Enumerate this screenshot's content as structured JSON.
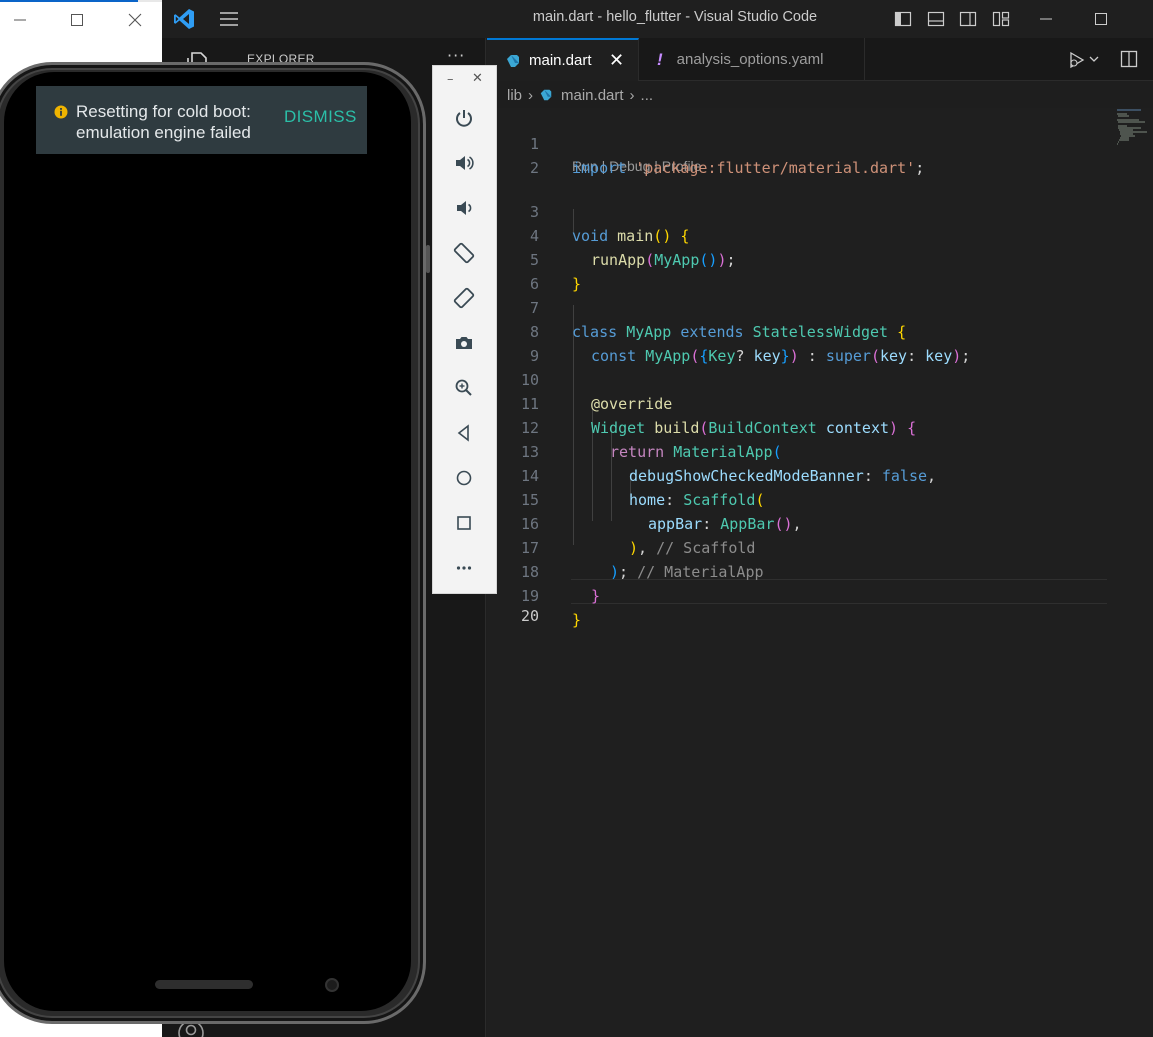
{
  "window": {
    "title": "main.dart - hello_flutter - Visual Studio Code"
  },
  "sidebar": {
    "title": "EXPLORER",
    "more": "···"
  },
  "tabs": [
    {
      "label": "main.dart",
      "active": true,
      "close": "✕"
    },
    {
      "label": "analysis_options.yaml",
      "active": false,
      "icon": "!"
    }
  ],
  "breadcrumb": {
    "folder": "lib",
    "file": "main.dart",
    "rest": "..."
  },
  "codelens": "Run | Debug | Profile",
  "line_numbers": [
    "1",
    "2",
    "3",
    "4",
    "5",
    "6",
    "7",
    "8",
    "9",
    "10",
    "11",
    "12",
    "13",
    "14",
    "15",
    "16",
    "17",
    "18",
    "19",
    "20"
  ],
  "code": {
    "l1": [
      "import",
      " ",
      "'package:flutter/material.dart'",
      ";"
    ],
    "l3": [
      "void",
      " ",
      "main",
      "(",
      ")",
      " ",
      "{"
    ],
    "l4": [
      "runApp",
      "(",
      "MyApp",
      "(",
      ")",
      ")",
      ";"
    ],
    "l5": [
      "}"
    ],
    "l7": [
      "class",
      " ",
      "MyApp",
      " ",
      "extends",
      " ",
      "StatelessWidget",
      " ",
      "{"
    ],
    "l8": [
      "const",
      " ",
      "MyApp",
      "(",
      "{",
      "Key",
      "?",
      " ",
      "key",
      "}",
      ")",
      " : ",
      "super",
      "(",
      "key",
      ": ",
      "key",
      ")",
      ";"
    ],
    "l10": [
      "@override"
    ],
    "l11": [
      "Widget",
      " ",
      "build",
      "(",
      "BuildContext",
      " ",
      "context",
      ")",
      " ",
      "{"
    ],
    "l12": [
      "return",
      " ",
      "MaterialApp",
      "("
    ],
    "l13": [
      "debugShowCheckedModeBanner",
      ": ",
      "false",
      ","
    ],
    "l14": [
      "home",
      ": ",
      "Scaffold",
      "("
    ],
    "l15": [
      "appBar",
      ": ",
      "AppBar",
      "(",
      ")",
      ","
    ],
    "l16": [
      ")",
      ", ",
      "// Scaffold"
    ],
    "l17": [
      ")",
      "; ",
      "// MaterialApp"
    ],
    "l18": [
      "}"
    ],
    "l19": [
      "}"
    ]
  },
  "emulator": {
    "notice_text": "Resetting for cold boot: emulation engine failed",
    "notice_action": "DISMISS",
    "toolbar": {
      "minimize": "–",
      "close": "✕",
      "buttons": [
        "power-icon",
        "volume-up-icon",
        "volume-down-icon",
        "rotate-left-icon",
        "rotate-right-icon",
        "camera-icon",
        "zoom-icon",
        "back-icon",
        "home-icon",
        "overview-icon",
        "more-icon"
      ]
    }
  },
  "colors": {
    "accent": "#0078d4",
    "editor_bg": "#1f1f1f",
    "notice_bg": "#2f3b40",
    "dismiss": "#2bbfa8"
  }
}
